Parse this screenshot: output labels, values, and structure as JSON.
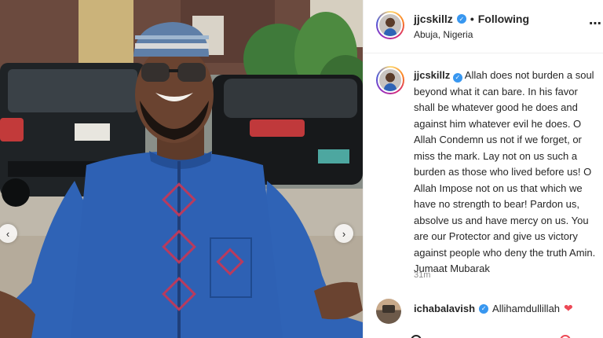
{
  "post": {
    "author": "jjcskillz",
    "verified_icon": "verified-badge-icon",
    "follow_state": "Following",
    "separator": "•",
    "location": "Abuja, Nigeria",
    "more_icon": "more-options-icon"
  },
  "caption": {
    "author": "jjcskillz",
    "text": "Allah does not burden a soul beyond what it can bare. In his favor shall be whatever good he does and against him whatever evil he does. O Allah Condemn us not if we forget, or miss the mark. Lay not on us such a burden as those who lived before us! O Allah Impose not on us that which we have no strength to bear! Pardon us, absolve us and have mercy on us. You are our Protector and give us victory against people who deny the truth Amin. Jumaat Mubarak",
    "time": "31m"
  },
  "comments": [
    {
      "author": "ichabalavish",
      "text": "Allihamdullillah",
      "emoji": "❤"
    }
  ],
  "carousel": {
    "prev": "‹",
    "next": "›"
  },
  "colors": {
    "verified": "#3897f0",
    "heart": "#ed4956",
    "agbada": "#2f63b6"
  }
}
